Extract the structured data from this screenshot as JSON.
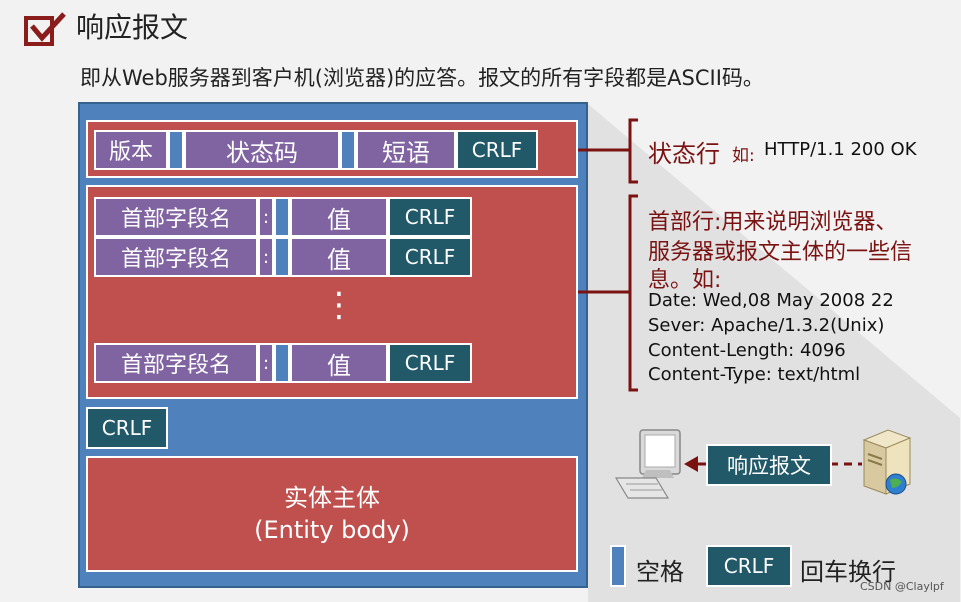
{
  "header": {
    "title": "响应报文",
    "subtitle": "即从Web服务器到客户机(浏览器)的应答。报文的所有字段都是ASCII码。"
  },
  "status_line": {
    "version": "版本",
    "status_code": "状态码",
    "phrase": "短语",
    "crlf": "CRLF",
    "label": "状态行",
    "example_prefix": "如:",
    "example": "HTTP/1.1 200 OK"
  },
  "header_lines": {
    "field_name": "首部字段名",
    "colon": ":",
    "value": "值",
    "crlf": "CRLF",
    "ellipsis": "⋮",
    "desc_line1": "首部行:用来说明浏览器、",
    "desc_line2": "服务器或报文主体的一些信",
    "desc_line3": "息。如:",
    "examples": [
      "Date:  Wed,08 May 2008 22",
      "Sever:  Apache/1.3.2(Unix)",
      "Content-Length:  4096",
      "Content-Type:  text/html"
    ]
  },
  "blank_line_crlf": "CRLF",
  "body": {
    "line1": "实体主体",
    "line2": "(Entity body)"
  },
  "flow": {
    "label": "响应报文"
  },
  "legend": {
    "space_label": "空格",
    "crlf_box": "CRLF",
    "crlf_label": "回车换行"
  },
  "watermark": "CSDN @Claylpf",
  "colors": {
    "outer_blue": "#4f81bd",
    "red": "#c0504d",
    "purple": "#8064a2",
    "teal": "#215968",
    "bracket": "#7a1212"
  }
}
